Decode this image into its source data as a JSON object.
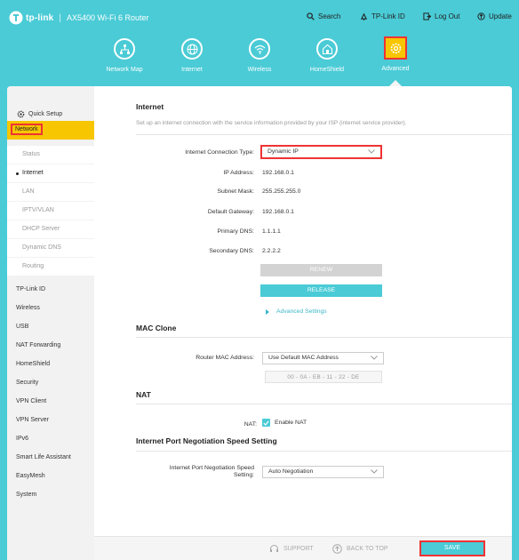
{
  "header": {
    "brand": "tp-link",
    "separator": "|",
    "model": "AX5400 Wi-Fi 6 Router",
    "search": "Search",
    "tplink_id": "TP-Link ID",
    "logout": "Log Out",
    "update": "Update"
  },
  "main_nav": [
    {
      "label": "Network Map",
      "icon": "network-map-icon"
    },
    {
      "label": "Internet",
      "icon": "globe-icon"
    },
    {
      "label": "Wireless",
      "icon": "wifi-icon"
    },
    {
      "label": "HomeShield",
      "icon": "home-shield-icon"
    },
    {
      "label": "Advanced",
      "icon": "gear-icon",
      "active": true
    }
  ],
  "sidebar": {
    "quick_setup": "Quick Setup",
    "network": "Network",
    "network_sub": [
      "Status",
      "Internet",
      "LAN",
      "IPTV/VLAN",
      "DHCP Server",
      "Dynamic DNS",
      "Routing"
    ],
    "active_sub": "Internet",
    "items": [
      "TP-Link ID",
      "Wireless",
      "USB",
      "NAT Forwarding",
      "HomeShield",
      "Security",
      "VPN Client",
      "VPN Server",
      "IPv6",
      "Smart Life Assistant",
      "EasyMesh",
      "System"
    ]
  },
  "internet": {
    "title": "Internet",
    "description": "Set up an internet connection with the service information provided by your ISP (internet service provider).",
    "conn_type_label": "Internet Connection Type:",
    "conn_type_value": "Dynamic IP",
    "ip_label": "IP Address:",
    "ip_value": "192.168.0.1",
    "mask_label": "Subnet Mask:",
    "mask_value": "255.255.255.0",
    "gateway_label": "Default Gateway:",
    "gateway_value": "192.168.0.1",
    "dns1_label": "Primary DNS:",
    "dns1_value": "1.1.1.1",
    "dns2_label": "Secondary DNS:",
    "dns2_value": "2.2.2.2",
    "renew": "RENEW",
    "release": "RELEASE",
    "advanced_settings": "Advanced Settings"
  },
  "mac_clone": {
    "title": "MAC Clone",
    "router_mac_label": "Router MAC Address:",
    "router_mac_value": "Use Default MAC Address",
    "mac_value": "00 - 0A - EB - 11 - 22 - DE"
  },
  "nat": {
    "title": "NAT",
    "nat_label": "NAT:",
    "enable_label": "Enable NAT",
    "enabled": true
  },
  "port_speed": {
    "title": "Internet Port Negotiation Speed Setting",
    "label_line1": "Internet Port Negotiation Speed",
    "label_line2": "Setting:",
    "value": "Auto Negotiation"
  },
  "footer": {
    "support": "SUPPORT",
    "back_to_top": "BACK TO TOP",
    "save": "SAVE"
  },
  "colors": {
    "accent": "#4acbd6",
    "active": "#f7c600",
    "highlight": "#e33333"
  }
}
